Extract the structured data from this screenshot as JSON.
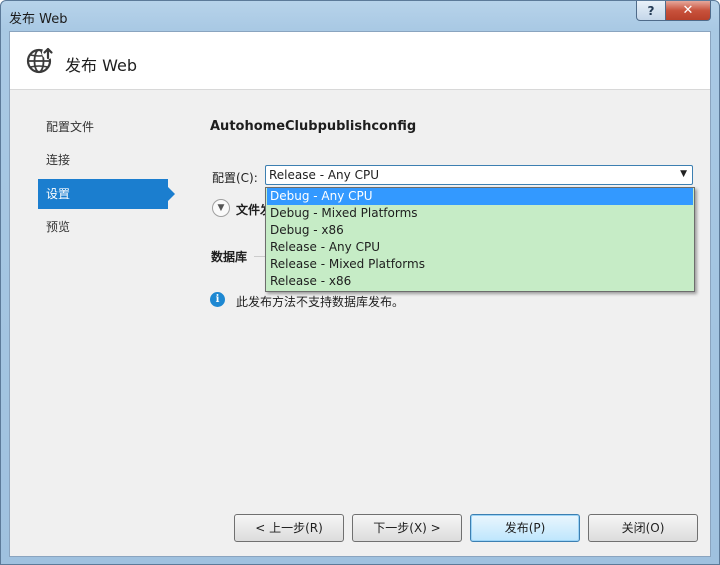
{
  "window": {
    "title": "发布 Web",
    "help_glyph": "?",
    "close_glyph": "✕"
  },
  "header": {
    "title": "发布 Web",
    "icon": "globe-publish-icon"
  },
  "nav": {
    "items": [
      {
        "label": "配置文件",
        "selected": false
      },
      {
        "label": "连接",
        "selected": false
      },
      {
        "label": "设置",
        "selected": true
      },
      {
        "label": "预览",
        "selected": false
      }
    ]
  },
  "main": {
    "profile_name": "AutohomeClubpublishconfig",
    "config_label": "配置(C):",
    "config_value": "Release - Any CPU",
    "expander_label": "文件发",
    "database_label": "数据库",
    "info_text": "此发布方法不支持数据库发布。",
    "info_glyph": "i"
  },
  "dropdown": {
    "options": [
      {
        "label": "Debug - Any CPU",
        "highlighted": true
      },
      {
        "label": "Debug - Mixed Platforms",
        "highlighted": false
      },
      {
        "label": "Debug - x86",
        "highlighted": false
      },
      {
        "label": "Release - Any CPU",
        "highlighted": false
      },
      {
        "label": "Release - Mixed Platforms",
        "highlighted": false
      },
      {
        "label": "Release - x86",
        "highlighted": false
      }
    ]
  },
  "buttons": {
    "prev": "< 上一步(R)",
    "next": "下一步(X) >",
    "publish": "发布(P)",
    "close": "关闭(O)"
  },
  "colors": {
    "accent": "#1b7ecf",
    "dropdown_bg": "#c6ecc6",
    "dropdown_highlight": "#3399ff",
    "info_icon": "#1e88d2"
  }
}
